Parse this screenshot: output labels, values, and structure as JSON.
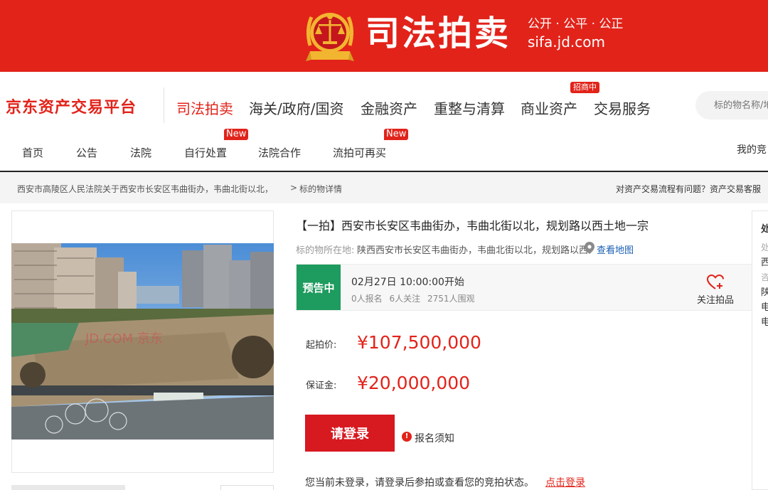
{
  "banner": {
    "title": "司法拍卖",
    "slogan": "公开 · 公平 · 公正",
    "url": "sifa.jd.com",
    "bg_color": "#e2231a"
  },
  "platform": {
    "logo_text": "京东资产交易平台",
    "nav": [
      "司法拍卖",
      "海关/政府/国资",
      "金融资产",
      "重整与清算",
      "商业资产",
      "交易服务"
    ],
    "recruit_badge": "招商中",
    "search_placeholder": "标的物名称/地"
  },
  "subnav": {
    "items": [
      "首页",
      "公告",
      "法院",
      "自行处置",
      "法院合作",
      "流拍可再买"
    ],
    "new_badge": "New",
    "my_bid": "我的竞"
  },
  "breadcrumb": {
    "court": "西安市高陵区人民法院关于西安市长安区韦曲街办，韦曲北街以北，",
    "separator": ">",
    "detail": "标的物详情",
    "help": "对资产交易流程有问题？资产交易客服"
  },
  "item": {
    "title": "【一拍】西安市长安区韦曲街办，韦曲北街以北，规划路以西土地一宗",
    "location_label": "标的物所在地:",
    "location_value": "陕西西安市长安区韦曲街办，韦曲北街以北，规划路以西",
    "map_link": "查看地图",
    "photo_watermark": "JD.COM 京东"
  },
  "status": {
    "tag": "预告中",
    "tag_color": "#1e9b5e",
    "start_time": "02月27日 10:00:00开始",
    "signups": "0人报名",
    "followers": "6人关注",
    "viewers": "2751人围观",
    "follow_label": "关注拍品"
  },
  "price": {
    "start_label": "起拍价:",
    "start_value": "¥107,500,000",
    "deposit_label": "保证金:",
    "deposit_value": "¥20,000,000",
    "accent_color": "#e2231a"
  },
  "actions": {
    "login_button": "请登录",
    "notice_icon": "!",
    "notice_link": "报名须知",
    "login_hint": "您当前未登录，请登录后参拍或查看您的竞拍状态。",
    "login_link": "点击登录"
  },
  "side": {
    "title": "处",
    "line1": "处",
    "line2": "西",
    "line3": "咨",
    "line4": "陕",
    "line5": "电",
    "line6": "电"
  }
}
